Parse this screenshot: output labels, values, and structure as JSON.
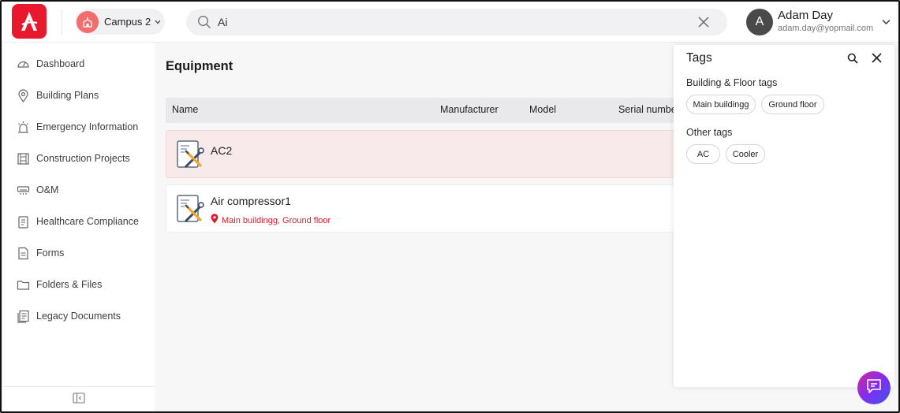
{
  "colors": {
    "brand": "#e8192c",
    "campus_accent": "#f26d6d",
    "location_red": "#e01b2b"
  },
  "header": {
    "logo_icon": "brand-logo-icon",
    "campus": {
      "label": "Campus 2",
      "icon": "campus-building-icon"
    },
    "search": {
      "value": "Ai",
      "icon": "search-icon",
      "clear_icon": "close-icon"
    },
    "user": {
      "initial": "A",
      "name": "Adam Day",
      "email": "adam.day@yopmail.com"
    }
  },
  "sidebar": {
    "items": [
      {
        "label": "Dashboard",
        "icon": "dashboard-icon"
      },
      {
        "label": "Building Plans",
        "icon": "location-pin-icon"
      },
      {
        "label": "Emergency Information",
        "icon": "siren-icon"
      },
      {
        "label": "Construction Projects",
        "icon": "construction-icon"
      },
      {
        "label": "O&M",
        "icon": "ac-unit-icon"
      },
      {
        "label": "Healthcare Compliance",
        "icon": "clipboard-icon"
      },
      {
        "label": "Forms",
        "icon": "form-icon"
      },
      {
        "label": "Folders & Files",
        "icon": "folder-icon"
      },
      {
        "label": "Legacy Documents",
        "icon": "documents-icon"
      }
    ]
  },
  "main": {
    "title": "Equipment",
    "columns": [
      "Name",
      "Manufacturer",
      "Model",
      "Serial numbe"
    ],
    "rows": [
      {
        "name": "AC2",
        "location": "",
        "selected": true
      },
      {
        "name": "Air compressor1",
        "location": "Main buildingg, Ground floor",
        "selected": false
      }
    ]
  },
  "tags_panel": {
    "title": "Tags",
    "groups": [
      {
        "label": "Building & Floor tags",
        "tags": [
          "Main buildingg",
          "Ground floor"
        ]
      },
      {
        "label": "Other tags",
        "tags": [
          "AC",
          "Cooler"
        ]
      }
    ]
  }
}
